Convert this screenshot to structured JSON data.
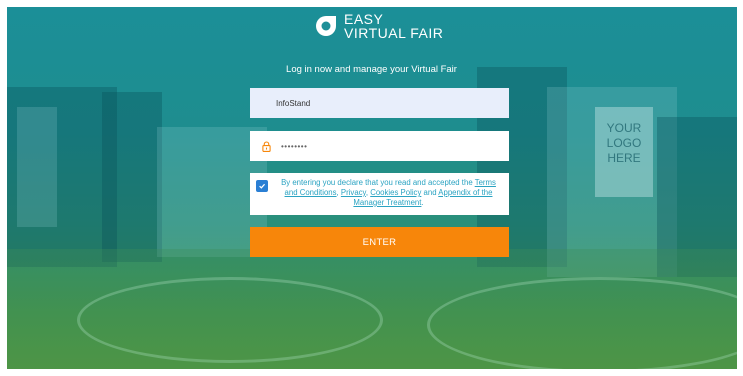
{
  "brand": {
    "line1": "EASY",
    "line2": "VIRTUAL FAIR"
  },
  "tagline": "Log in now and manage your Virtual Fair",
  "username": {
    "value": "InfoStand"
  },
  "password": {
    "value": "••••••••",
    "icon": "lock-icon"
  },
  "consent": {
    "checked": true,
    "prefix": "By entering you declare that you read and accepted the ",
    "terms": "Terms and Conditions",
    "sep1": ", ",
    "privacy": "Privacy",
    "sep2": ", ",
    "cookies": "Cookies Policy",
    "sep3": " and ",
    "appendix": "Appendix of the Manager Treatment",
    "suffix": "."
  },
  "enter_label": "ENTER",
  "banner_text": [
    "YOUR",
    "LOGO",
    "HERE"
  ],
  "colors": {
    "accent": "#f7860a",
    "link": "#2aa3c2",
    "overlay": "#1b8f98"
  }
}
